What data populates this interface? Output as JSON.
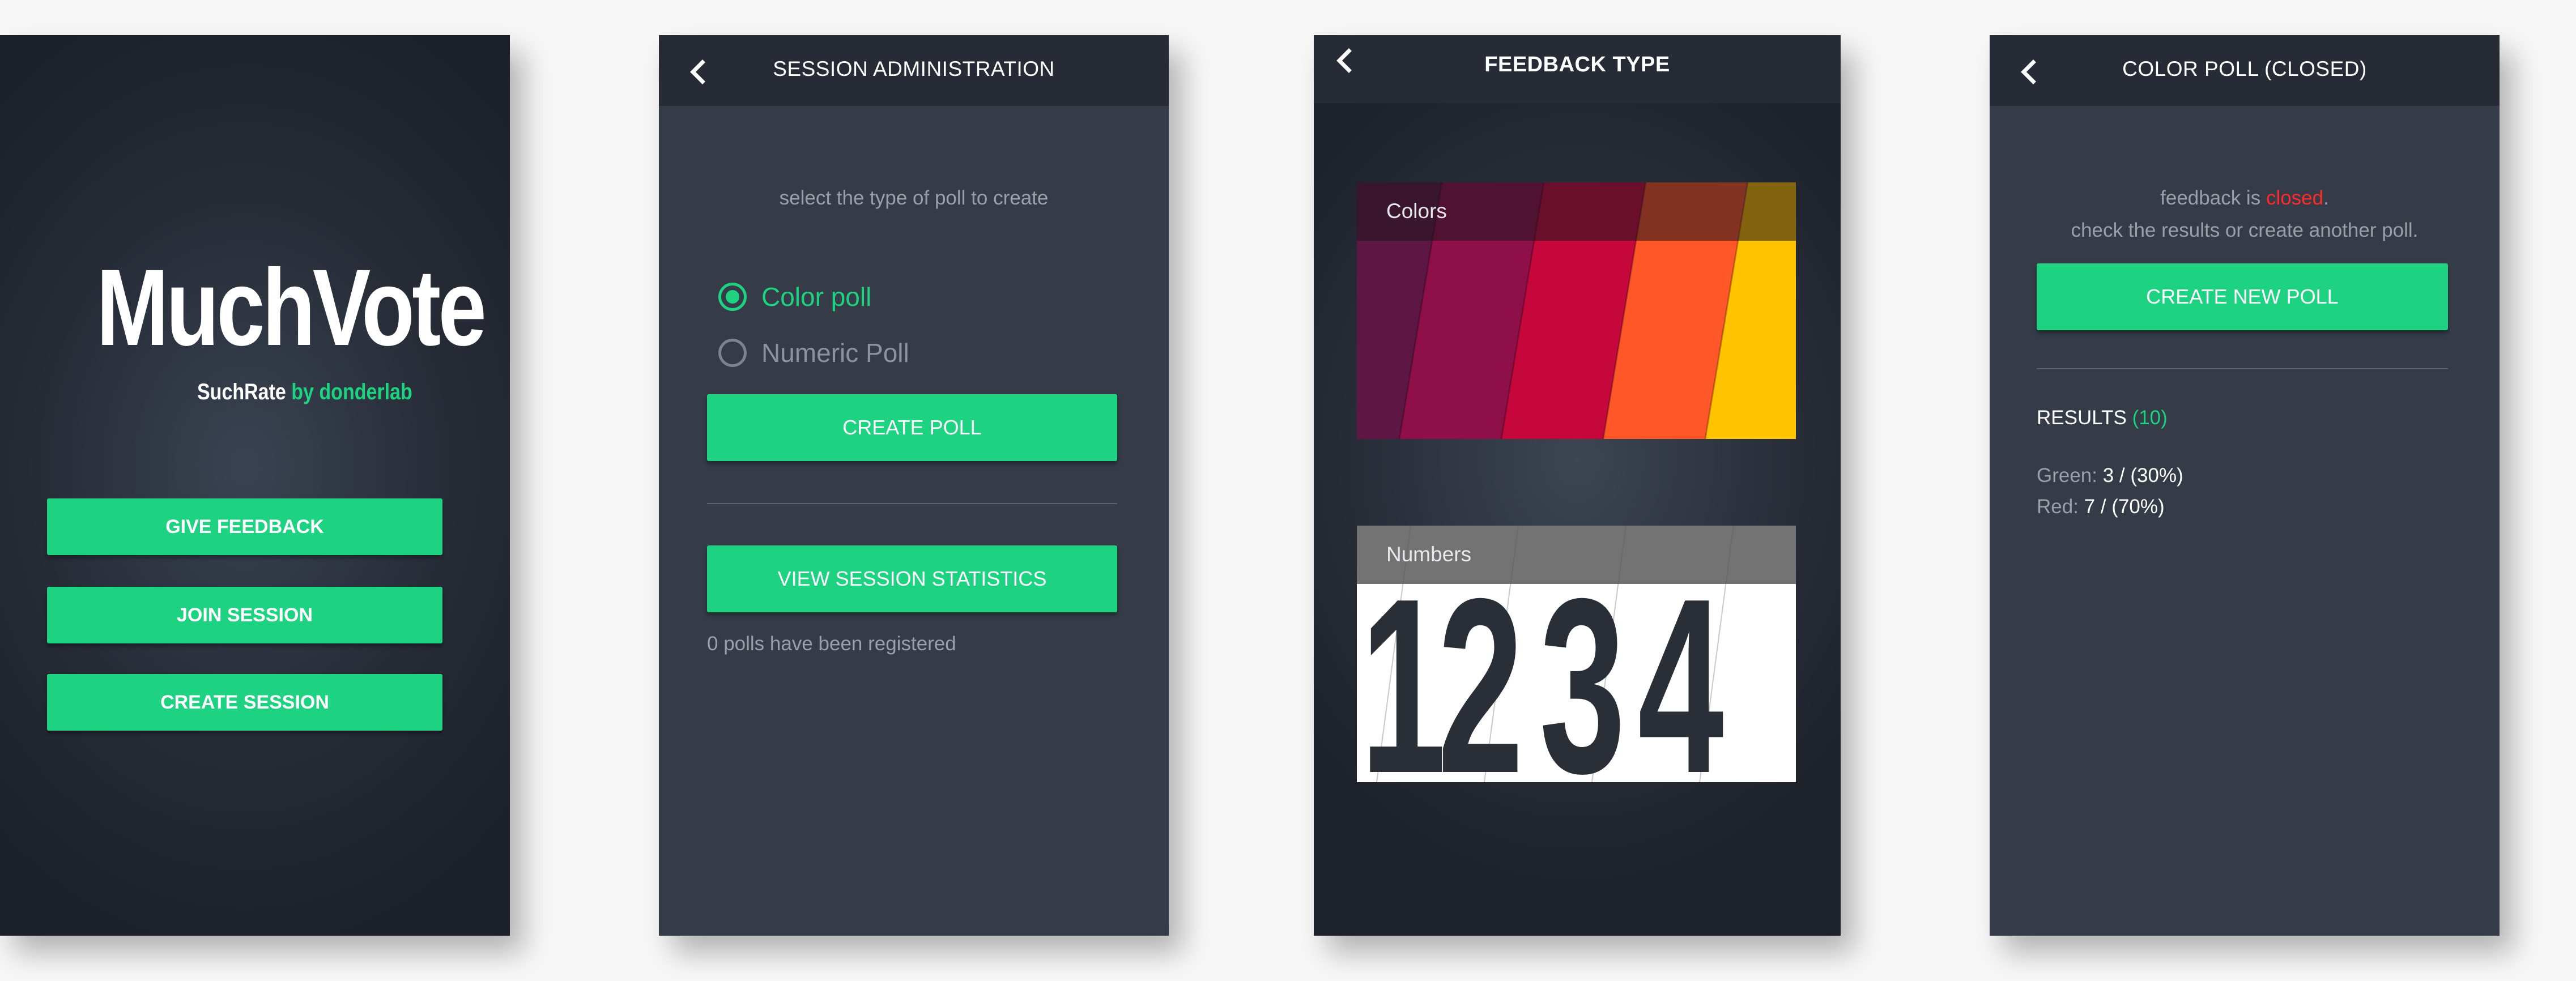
{
  "screen1": {
    "logo": {
      "title": "MuchVote",
      "sub_name": "SuchRate",
      "sub_by": "by donderlab"
    },
    "buttons": {
      "give_feedback": "GIVE FEEDBACK",
      "join_session": "JOIN SESSION",
      "create_session": "CREATE SESSION"
    }
  },
  "screen2": {
    "title": "SESSION ADMINISTRATION",
    "instruction": "select the type of poll to create",
    "options": [
      {
        "label": "Color poll",
        "selected": true
      },
      {
        "label": "Numeric Poll",
        "selected": false
      }
    ],
    "create_poll": "CREATE POLL",
    "view_stats": "VIEW SESSION STATISTICS",
    "polls_registered": "0 polls have been registered"
  },
  "screen3": {
    "title": "FEEDBACK TYPE",
    "tiles": {
      "colors": "Colors",
      "numbers": "Numbers",
      "digits": [
        "1",
        "2",
        "3",
        "4"
      ]
    },
    "palette": [
      "#5e1744",
      "#8f1048",
      "#c5073c",
      "#ff5727",
      "#ffc300"
    ]
  },
  "screen4": {
    "title": "COLOR POLL (CLOSED)",
    "status_prefix": "feedback is ",
    "status_value": "closed",
    "status_suffix": ".",
    "instruction": "check the results or create another poll.",
    "create_new_poll": "CREATE NEW POLL",
    "results_label": "RESULTS ",
    "results_count": "(10)",
    "results": [
      {
        "label": "Green:",
        "value": "3 / (30%)"
      },
      {
        "label": "Red:",
        "value": "7 / (70%)"
      }
    ]
  },
  "colors": {
    "accent": "#1dd382",
    "closed": "#ff2a2a",
    "topbar": "#272b35",
    "panel": "#353b47"
  },
  "icons": {
    "back": "chevron-left-icon",
    "radio_on": "radio-checked-icon",
    "radio_off": "radio-unchecked-icon"
  }
}
